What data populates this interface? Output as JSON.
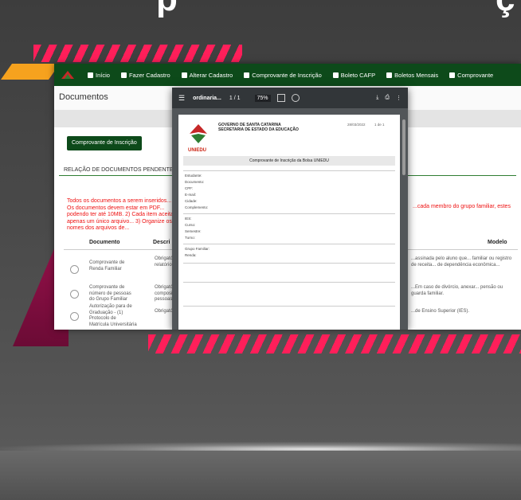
{
  "banner": {
    "title_fragment_left": "p",
    "title_fragment_right": "ç"
  },
  "colors": {
    "stripe": "#ff1f5a",
    "orange": "#f6a21e",
    "maroon": "#8c0f44",
    "nav_green": "#0d4a1a"
  },
  "navbar": {
    "items": [
      {
        "label": "Início",
        "icon": "home-icon"
      },
      {
        "label": "Fazer Cadastro",
        "icon": "edit-icon"
      },
      {
        "label": "Alterar Cadastro",
        "icon": "edit-icon"
      },
      {
        "label": "Comprovante de Inscrição",
        "icon": "document-icon"
      },
      {
        "label": "Boleto CAFP",
        "icon": "barcode-icon"
      },
      {
        "label": "Boletos Mensais",
        "icon": "calendar-icon"
      },
      {
        "label": "Comprovante",
        "icon": "file-icon"
      }
    ]
  },
  "page": {
    "title": "Documentos"
  },
  "proof_button": "Comprovante de Inscrição",
  "section_title": "RELAÇÃO DE DOCUMENTOS PENDENTES",
  "red_notice_left": "Todos os documentos a serem inseridos... 1) Os documentos devem estar em PDF... podendo ter até 10MB. 2) Cada item aceita apenas um único arquivo... 3) Organize os nomes dos arquivos de...",
  "red_notice_right": "...cada membro do grupo familiar, estes",
  "table": {
    "headers": {
      "document": "Documento",
      "description": "Descri",
      "model": "Modelo"
    },
    "rows": [
      {
        "doc": "Comprovante de Renda Familiar",
        "mid": "Obrigatório... relatório...",
        "desc": "...assinada pelo aluno que... familiar ou registro de receita... de dependência econômica..."
      },
      {
        "doc": "Comprovante de número de pessoas do Grupo Familiar",
        "mid": "Obrigatório... composição... pessoas...",
        "desc": "...Em caso de divórcio, anexar... pensão ou guarda familiar."
      },
      {
        "doc": "Autorização para de Graduação - (1) Protocolo de Matrícula Universitária",
        "mid": "Obrigatório...",
        "desc": "...de Ensino Superior (IES)."
      }
    ]
  },
  "pdf_viewer": {
    "filename": "ordinaria...",
    "page_indicator": "1 / 1",
    "zoom": "75%",
    "doc": {
      "org_line1": "GOVERNO DE SANTA CATARINA",
      "org_line2": "SECRETARIA DE ESTADO DA EDUCAÇÃO",
      "logo_text": "UNIEDU",
      "date_label": "28/03/2022",
      "page_label": "1 de 1",
      "title": "Comprovante de Inscrição da Bolsa UNIEDU",
      "fields": [
        "Estudante: ",
        "Documento: ",
        "CPF: ",
        "E-mail: ",
        "Cidade: ",
        "Complemento: ",
        "IES: ",
        "Curso: ",
        "Semestre: ",
        "Turno: ",
        "Grupo Familiar: ",
        "Renda: "
      ]
    }
  }
}
